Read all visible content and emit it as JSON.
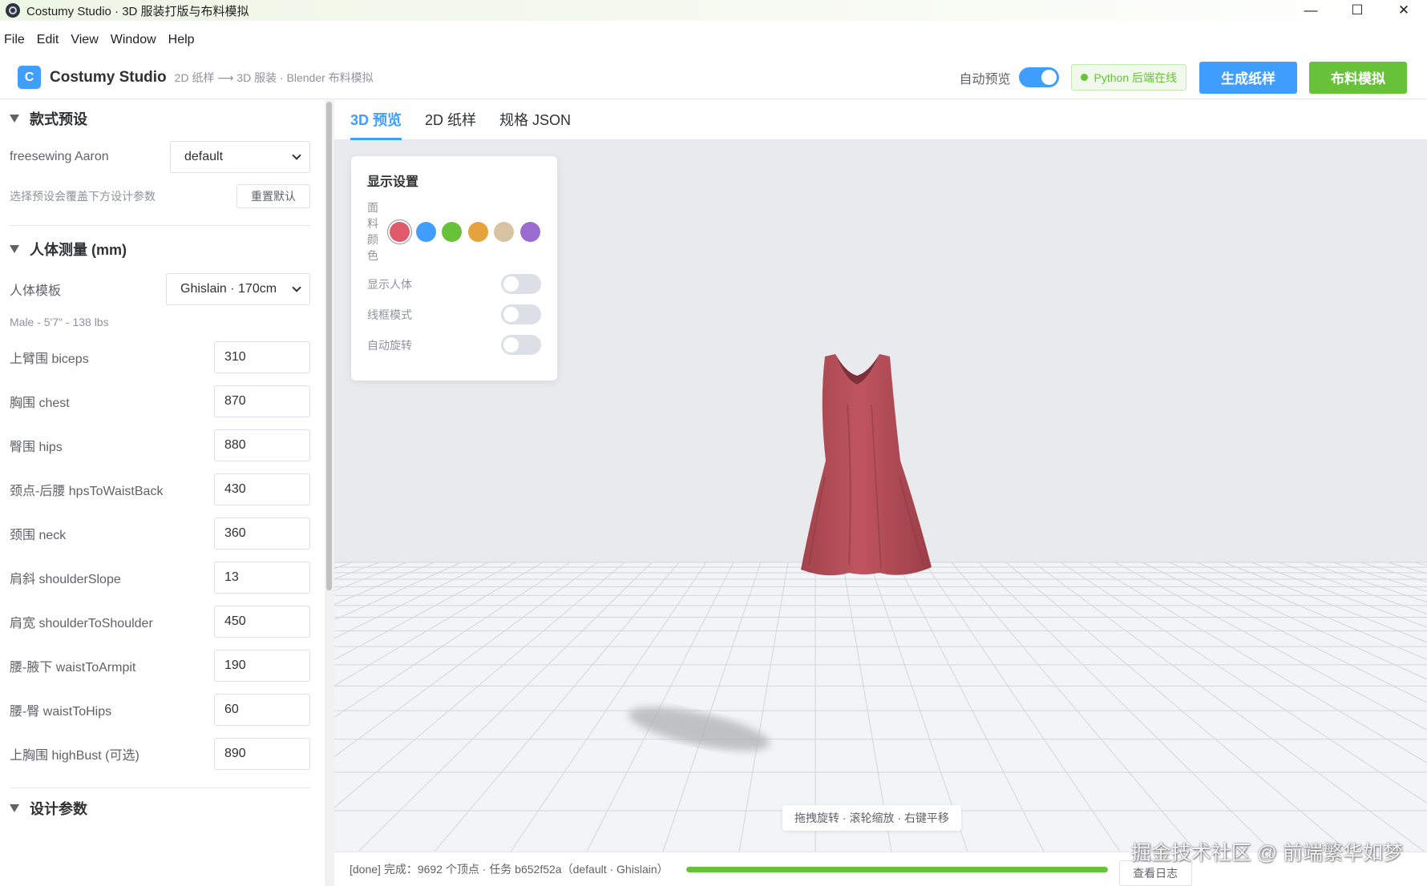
{
  "window": {
    "title": "Costumy Studio · 3D 服装打版与布料模拟",
    "controls": [
      "—",
      "☐",
      "✕"
    ]
  },
  "menu": [
    "File",
    "Edit",
    "View",
    "Window",
    "Help"
  ],
  "header": {
    "logo_letter": "C",
    "brand": "Costumy Studio",
    "pipeline": "2D 纸样 ⟶ 3D 服装 · Blender 布料模拟",
    "auto_preview_label": "自动预览",
    "auto_preview_on": true,
    "backend_status": "Python 后端在线",
    "generate_button": "生成纸样",
    "simulate_button": "布料模拟"
  },
  "sidebar": {
    "preset_section": {
      "title": "款式预设",
      "pattern_label": "freesewing Aaron",
      "preset_value": "default",
      "hint": "选择预设会覆盖下方设计参数",
      "reset_button": "重置默认"
    },
    "body_section": {
      "title": "人体测量 (mm)",
      "template_label": "人体模板",
      "template_value": "Ghislain · 170cm",
      "template_info": "Male - 5'7\" - 138 lbs",
      "measurements": [
        {
          "label": "上臂围 biceps",
          "value": "310"
        },
        {
          "label": "胸围 chest",
          "value": "870"
        },
        {
          "label": "臀围 hips",
          "value": "880"
        },
        {
          "label": "颈点-后腰 hpsToWaistBack",
          "value": "430"
        },
        {
          "label": "颈围 neck",
          "value": "360"
        },
        {
          "label": "肩斜 shoulderSlope",
          "value": "13"
        },
        {
          "label": "肩宽 shoulderToShoulder",
          "value": "450"
        },
        {
          "label": "腰-腋下 waistToArmpit",
          "value": "190"
        },
        {
          "label": "腰-臀 waistToHips",
          "value": "60"
        },
        {
          "label": "上胸围 highBust (可选)",
          "value": "890"
        }
      ]
    },
    "design_section": {
      "title": "设计参数"
    }
  },
  "tabs": [
    {
      "label": "3D 预览",
      "active": true
    },
    {
      "label": "2D 纸样",
      "active": false
    },
    {
      "label": "规格 JSON",
      "active": false
    }
  ],
  "display_panel": {
    "title": "显示设置",
    "color_label": "面料颜色",
    "colors": [
      "#e05a6b",
      "#409eff",
      "#67c23a",
      "#e6a23c",
      "#d9c3a5",
      "#9b6cd0"
    ],
    "selected_color": "#e05a6b",
    "options": [
      {
        "label": "显示人体",
        "on": false
      },
      {
        "label": "线框模式",
        "on": false
      },
      {
        "label": "自动旋转",
        "on": false
      }
    ]
  },
  "viewport_hint": "拖拽旋转 · 滚轮缩放 · 右键平移",
  "status": {
    "text": "[done] 完成：9692 个顶点 · 任务 b652f52a（default · Ghislain）",
    "progress": 1.0,
    "log_button": "查看日志"
  },
  "watermark": "掘金技术社区 @ 前端繁华如梦",
  "colors": {
    "primary": "#409eff",
    "success": "#67c23a",
    "garment": "#b84f57"
  }
}
